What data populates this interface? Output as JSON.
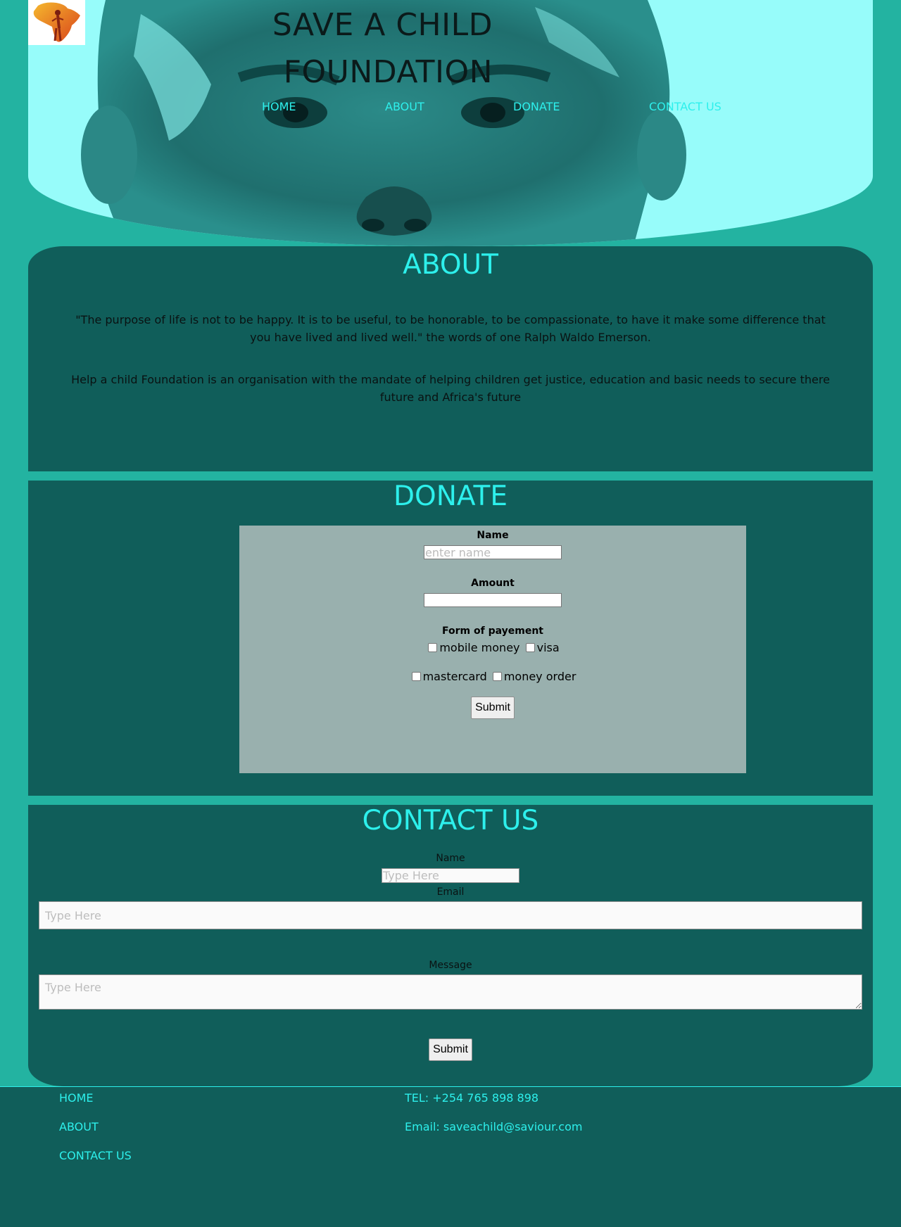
{
  "brand": {
    "title_line1": "SAVE A CHILD",
    "title_line2": "FOUNDATION"
  },
  "nav": {
    "home": "HOME",
    "about": "ABOUT",
    "donate": "DONATE",
    "contact": "CONTACT US"
  },
  "about": {
    "title": "ABOUT",
    "quote": "\"The purpose of life is not to be happy. It is to be useful, to be honorable, to be compassionate, to have it make some difference that you have lived and lived well.\" the words of one Ralph Waldo Emerson.",
    "mission": "Help a child Foundation is an organisation with the mandate of helping children get justice, education and basic needs to secure there future and Africa's future"
  },
  "donate": {
    "title": "DONATE",
    "name_label": "Name",
    "name_placeholder": "enter name",
    "amount_label": "Amount",
    "amount_value": "",
    "payment_label": "Form of payement",
    "options": [
      "mobile money",
      "visa",
      "mastercard",
      "money order"
    ],
    "submit": "Submit"
  },
  "contact": {
    "title": "CONTACT US",
    "name_label": "Name",
    "name_placeholder": "Type Here",
    "email_label": "Email",
    "email_placeholder": "Type Here",
    "message_label": "Message",
    "message_placeholder": "Type Here",
    "submit": "Submit"
  },
  "footer": {
    "links": [
      "HOME",
      "ABOUT",
      "CONTACT US"
    ],
    "tel": "TEL: +254 765 898 898",
    "email": "Email: saveachild@saviour.com"
  },
  "colors": {
    "page_bg": "#23b3a1",
    "hero_bg": "#97fcfa",
    "section_bg": "#105e5a",
    "accent": "#2df0ec",
    "form_bg": "#99b0ae"
  }
}
